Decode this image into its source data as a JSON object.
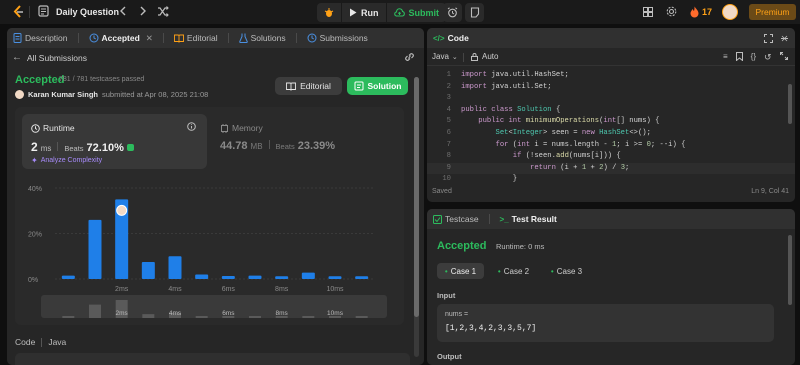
{
  "topbar": {
    "title": "Daily Question",
    "run_label": "Run",
    "submit_label": "Submit",
    "streak": "17",
    "premium_label": "Premium"
  },
  "left_tabs": [
    {
      "label": "Description",
      "icon": "document-icon"
    },
    {
      "label": "Accepted",
      "icon": "history-icon"
    },
    {
      "label": "Editorial",
      "icon": "book-icon"
    },
    {
      "label": "Solutions",
      "icon": "flask-icon"
    },
    {
      "label": "Submissions",
      "icon": "history-icon"
    }
  ],
  "submission": {
    "back_label": "All Submissions",
    "status": "Accepted",
    "testcases": "781 / 781 testcases passed",
    "user": "Karan Kumar Singh",
    "submitted": "submitted at Apr 08, 2025 21:08",
    "editorial_btn": "Editorial",
    "solution_btn": "Solution"
  },
  "runtime": {
    "label": "Runtime",
    "value": "2",
    "unit": "ms",
    "beats_label": "Beats",
    "beats": "72.10%",
    "analyze": "Analyze Complexity"
  },
  "memory": {
    "label": "Memory",
    "value": "44.78",
    "unit": "MB",
    "beats_label": "Beats",
    "beats": "23.39%"
  },
  "chart_data": {
    "type": "bar",
    "x_ticks": [
      "2ms",
      "4ms",
      "6ms",
      "8ms",
      "10ms"
    ],
    "y_ticks": [
      "40%",
      "20%",
      "0%"
    ],
    "ylim": [
      0,
      40
    ],
    "values": [
      1.5,
      26,
      35,
      7.5,
      10,
      2,
      1.3,
      1.5,
      1.2,
      2.8,
      1.2,
      1.2
    ],
    "highlight_index": 2
  },
  "code_footer": {
    "label": "Code",
    "lang": "Java"
  },
  "editor": {
    "title": "Code",
    "lang": "Java",
    "mode": "Auto",
    "status": "Saved",
    "cursor": "Ln 9, Col 41",
    "lines": [
      {
        "n": "1",
        "html": "<span class='kw'>import</span> <span class='pl'>java.util.HashSet;</span>"
      },
      {
        "n": "2",
        "html": "<span class='kw'>import</span> <span class='pl'>java.util.Set;</span>"
      },
      {
        "n": "3",
        "html": ""
      },
      {
        "n": "4",
        "html": "<span class='kw'>public class</span> <span class='ty'>Solution</span> <span class='pl'>{</span>"
      },
      {
        "n": "5",
        "html": "    <span class='kw'>public int</span> <span class='fn'>minimumOperations</span><span class='pl'>(</span><span class='kw'>int</span><span class='pl'>[] nums) {</span>"
      },
      {
        "n": "6",
        "html": "        <span class='ty'>Set</span><span class='pl'>&lt;</span><span class='ty'>Integer</span><span class='pl'>&gt; seen = </span><span class='kw'>new</span> <span class='ty'>HashSet</span><span class='pl'>&lt;&gt;();</span>"
      },
      {
        "n": "7",
        "html": "        <span class='kw'>for</span> <span class='pl'>(</span><span class='kw'>int</span> <span class='pl'>i = nums.length - </span><span class='num'>1</span><span class='pl'>; i &gt;= </span><span class='num'>0</span><span class='pl'>; --i) {</span>"
      },
      {
        "n": "8",
        "html": "            <span class='kw'>if</span> <span class='pl'>(!seen.</span><span class='fn'>add</span><span class='pl'>(nums[i])) {</span>"
      },
      {
        "n": "9",
        "html": "                <span class='kw'>return</span> <span class='pl'>(i + </span><span class='num'>1</span> <span class='pl'>+ </span><span class='num'>2</span><span class='pl'>) / </span><span class='num'>3</span><span class='pl'>;</span>"
      },
      {
        "n": "10",
        "html": "            <span class='pl'>}</span>"
      }
    ]
  },
  "testpanel": {
    "tab_testcase": "Testcase",
    "tab_result": "Test Result",
    "status": "Accepted",
    "runtime": "Runtime: 0 ms",
    "cases": [
      "Case 1",
      "Case 2",
      "Case 3"
    ],
    "input_label": "Input",
    "var_name": "nums =",
    "var_value": "[1,2,3,4,2,3,3,5,7]",
    "output_label": "Output"
  }
}
